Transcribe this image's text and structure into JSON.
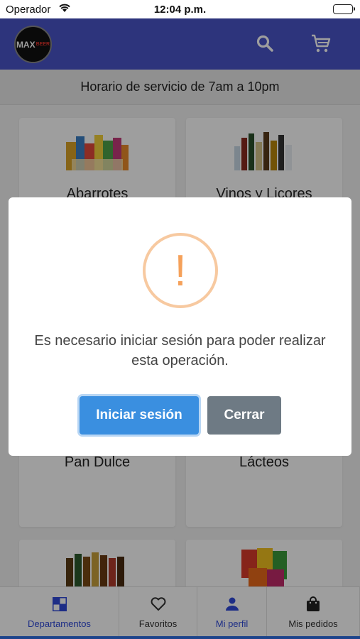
{
  "status": {
    "carrier": "Operador",
    "time": "12:04 p.m."
  },
  "header": {
    "logo_text": "MAX",
    "logo_sub": "BEER",
    "icons": [
      "search-icon",
      "cart-icon"
    ]
  },
  "service_banner": "Horario de servicio de 7am a 10pm",
  "departments": [
    {
      "label": "Abarrotes"
    },
    {
      "label": "Vinos y Licores"
    },
    {
      "label": "Pan Dulce"
    },
    {
      "label": "Lácteos"
    }
  ],
  "dialog": {
    "icon": "warning-icon",
    "message": "Es necesario iniciar sesión para poder realizar esta operación.",
    "primary_label": "Iniciar sesión",
    "secondary_label": "Cerrar"
  },
  "tabs": [
    {
      "label": "Departamentos",
      "icon": "grid-icon",
      "active": true
    },
    {
      "label": "Favoritos",
      "icon": "heart-icon",
      "active": false
    },
    {
      "label": "Mi perfil",
      "icon": "user-icon",
      "active": true
    },
    {
      "label": "Mis pedidos",
      "icon": "bag-icon",
      "active": false
    }
  ],
  "colors": {
    "header": "#4a55c9",
    "primary_button": "#3a8fe0",
    "secondary_button": "#6e7a84",
    "warning": "#f5a15a",
    "tab_active": "#2f4ad8"
  }
}
